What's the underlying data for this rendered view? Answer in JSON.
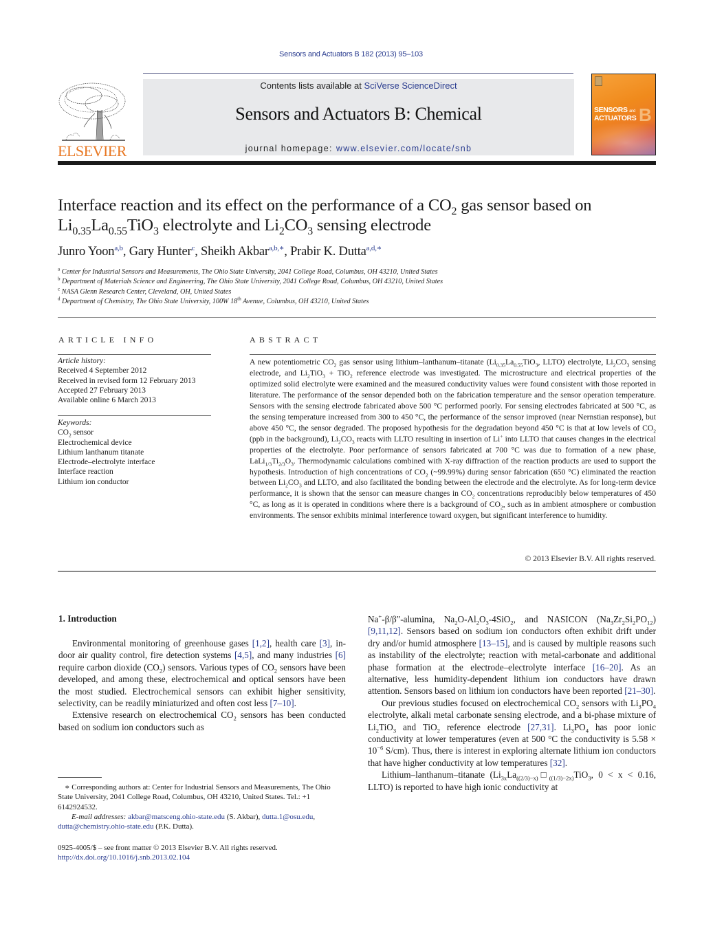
{
  "header": {
    "journal_ref": "Sensors and Actuators B 182 (2013) 95–103",
    "contents_prefix": "Contents lists available at ",
    "contents_link": "SciVerse ScienceDirect",
    "journal_name": "Sensors and Actuators B: Chemical",
    "homepage_prefix": "journal homepage: ",
    "homepage_url": "www.elsevier.com/locate/snb",
    "publisher_logo_text": "ELSEVIER",
    "cover": {
      "line1": "SENSORS",
      "line1_small": "and",
      "line2": "ACTUATORS",
      "letter": "B"
    }
  },
  "article": {
    "title_parts": {
      "t1": "Interface reaction and its effect on the performance of a CO",
      "t1_sub": "2",
      "t2": " gas sensor based on",
      "t3": "Li",
      "t3_sub": "0.35",
      "t4": "La",
      "t4_sub": "0.55",
      "t5": "TiO",
      "t5_sub": "3",
      "t6": " electrolyte and Li",
      "t6_sub": "2",
      "t7": "CO",
      "t7_sub": "3",
      "t8": " sensing electrode"
    },
    "authors": [
      {
        "name": "Junro Yoon",
        "sup": "a,b",
        "sep": ", "
      },
      {
        "name": "Gary Hunter",
        "sup": "c",
        "sep": ", "
      },
      {
        "name": "Sheikh Akbar",
        "sup": "a,b,∗",
        "sep": ", "
      },
      {
        "name": "Prabir K. Dutta",
        "sup": "a,d,∗",
        "sep": ""
      }
    ],
    "affiliations": [
      {
        "key": "a",
        "text": "Center for Industrial Sensors and Measurements, The Ohio State University, 2041 College Road, Columbus, OH 43210, United States"
      },
      {
        "key": "b",
        "text": "Department of Materials Science and Engineering, The Ohio State University, 2041 College Road, Columbus, OH 43210, United States"
      },
      {
        "key": "c",
        "text": "NASA Glenn Research Center, Cleveland, OH, United States"
      },
      {
        "key": "d",
        "text_pre": "Department of Chemistry, The Ohio State University, 100W 18",
        "text_sup": "th",
        "text_post": " Avenue, Columbus, OH 43210, United States"
      }
    ]
  },
  "article_info": {
    "heading": "ARTICLE INFO",
    "history_label": "Article history:",
    "history": [
      "Received 4 September 2012",
      "Received in revised form 12 February 2013",
      "Accepted 27 February 2013",
      "Available online 6 March 2013"
    ],
    "keywords_label": "Keywords:",
    "keyword_first": {
      "pre": "CO",
      "sub": "2",
      "post": " sensor"
    },
    "keywords": [
      "Electrochemical device",
      "Lithium lanthanum titanate",
      "Electrode–electrolyte interface",
      "Interface reaction",
      "Lithium ion conductor"
    ]
  },
  "abstract": {
    "heading": "ABSTRACT",
    "segments": {
      "s1": "A new potentiometric CO",
      "s2": " gas sensor using lithium–lanthanum–titanate (Li",
      "s3": "La",
      "s4": "TiO",
      "s5": ", LLTO) electrolyte, Li",
      "s6": "CO",
      "s7": " sensing electrode, and Li",
      "s8": "TiO",
      "s9": " + TiO",
      "s10": " reference electrode was investigated. The microstructure and electrical properties of the optimized solid electrolyte were examined and the measured conductivity values were found consistent with those reported in literature. The performance of the sensor depended both on the fabrication temperature and the sensor operation temperature. Sensors with the sensing electrode fabricated above 500 °C performed poorly. For sensing electrodes fabricated at 500 °C, as the sensing temperature increased from 300 to 450 °C, the performance of the sensor improved (near Nernstian response), but above 450 °C, the sensor degraded. The proposed hypothesis for the degradation beyond 450 °C is that at low levels of CO",
      "s11": " (ppb in the background), Li",
      "s12": "CO",
      "s13": " reacts with LLTO resulting in insertion of Li",
      "s14": " into LLTO that causes changes in the electrical properties of the electrolyte. Poor performance of sensors fabricated at 700 °C was due to formation of a new phase, LaLi",
      "s15": "Ti",
      "s16": "O",
      "s17": ". Thermodynamic calculations combined with X-ray diffraction of the reaction products are used to support the hypothesis. Introduction of high concentrations of CO",
      "s18": " (~99.99%) during sensor fabrication (650 °C) eliminated the reaction between Li",
      "s19": "CO",
      "s20": " and LLTO, and also facilitated the bonding between the electrode and the electrolyte. As for long-term device performance, it is shown that the sensor can measure changes in CO",
      "s21": " concentrations reproducibly below temperatures of 450 °C, as long as it is operated in conditions where there is a background of CO",
      "s22": ", such as in ambient atmosphere or combustion environments. The sensor exhibits minimal interference toward oxygen, but significant interference to humidity."
    },
    "subs": {
      "two": "2",
      "three": "3",
      "li035": "0.35",
      "la055": "0.55",
      "plus": "+",
      "one_third": "1/3",
      "two_third": "2/3"
    },
    "copyright": "© 2013 Elsevier B.V. All rights reserved."
  },
  "introduction": {
    "heading": "1.  Introduction",
    "left": {
      "p1": {
        "a": "Environmental monitoring of greenhouse gases ",
        "r1": "[1,2]",
        "b": ", health care ",
        "r2": "[3]",
        "c": ", in-door air quality control, fire detection systems ",
        "r3": "[4,5]",
        "d": ", and many industries ",
        "r4": "[6]",
        "e": " require carbon dioxide (CO",
        "f": ") sensors. Various types of CO",
        "g": " sensors have been developed, and among these, electrochemical and optical sensors have been the most studied. Electrochemical sensors can exhibit higher sensitivity, selectivity, can be readily miniaturized and often cost less ",
        "r5": "[7–10]",
        "h": "."
      },
      "p2": {
        "a": "Extensive research on electrochemical CO",
        "b": " sensors has been conducted based on sodium ion conductors such as"
      }
    },
    "right": {
      "p1": {
        "a": "Na",
        "b": "-β/β″-alumina, Na",
        "c": "O-Al",
        "d": "O",
        "e": "-4SiO",
        "f": ", and NASICON (Na",
        "g": "Zr",
        "h": "Si",
        "i": "PO",
        "j": ") ",
        "r1": "[9,11,12]",
        "k": ". Sensors based on sodium ion conductors often exhibit drift under dry and/or humid atmosphere ",
        "r2": "[13–15]",
        "l": ", and is caused by multiple reasons such as instability of the electrolyte; reaction with metal-carbonate and additional phase formation at the electrode–electrolyte interface ",
        "r3": "[16–20]",
        "m": ". As an alternative, less humidity-dependent lithium ion conductors have drawn attention. Sensors based on lithium ion conductors have been reported ",
        "r4": "[21–30]",
        "n": "."
      },
      "p2": {
        "a": "Our previous studies focused on electrochemical CO",
        "b": " sensors with Li",
        "c": "PO",
        "d": " electrolyte, alkali metal carbonate sensing electrode, and a bi-phase mixture of Li",
        "e": "TiO",
        "f": " and TiO",
        "g": " reference electrode ",
        "r1": "[27,31]",
        "h": ". Li",
        "i": "PO",
        "j": " has poor ionic conductivity at lower temperatures (even at 500 °C the conductivity is 5.58 × 10",
        "exp": "−6",
        "k": " S/cm). Thus, there is interest in exploring alternate lithium ion conductors that have higher conductivity at low temperatures ",
        "r2": "[32]",
        "l": "."
      },
      "p3": {
        "a": "Lithium–lanthanum–titanate (Li",
        "s1": "3x",
        "b": "La",
        "s2": "((2/3)−x)",
        "box": "□",
        "s3": "((1/3)−2x)",
        "c": "TiO",
        "s4": "3",
        "d": ", 0 < x < 0.16, LLTO) is reported to have high ionic conductivity at"
      }
    }
  },
  "footnotes": {
    "corresponding": "∗ Corresponding authors at: Center for Industrial Sensors and Measurements, The Ohio State University, 2041 College Road, Columbus, OH 43210, United States. Tel.: +1 6142924532.",
    "email_label": "E-mail addresses: ",
    "email1": "akbar@matsceng.ohio-state.edu",
    "email1_owner": " (S. Akbar), ",
    "email2": "dutta.1@osu.edu",
    "email2_sep": ", ",
    "email3": "dutta@chemistry.ohio-state.edu",
    "email3_owner": " (P.K. Dutta).",
    "front_matter": "0925-4005/$ – see front matter © 2013 Elsevier B.V. All rights reserved.",
    "doi": "http://dx.doi.org/10.1016/j.snb.2013.02.104"
  }
}
